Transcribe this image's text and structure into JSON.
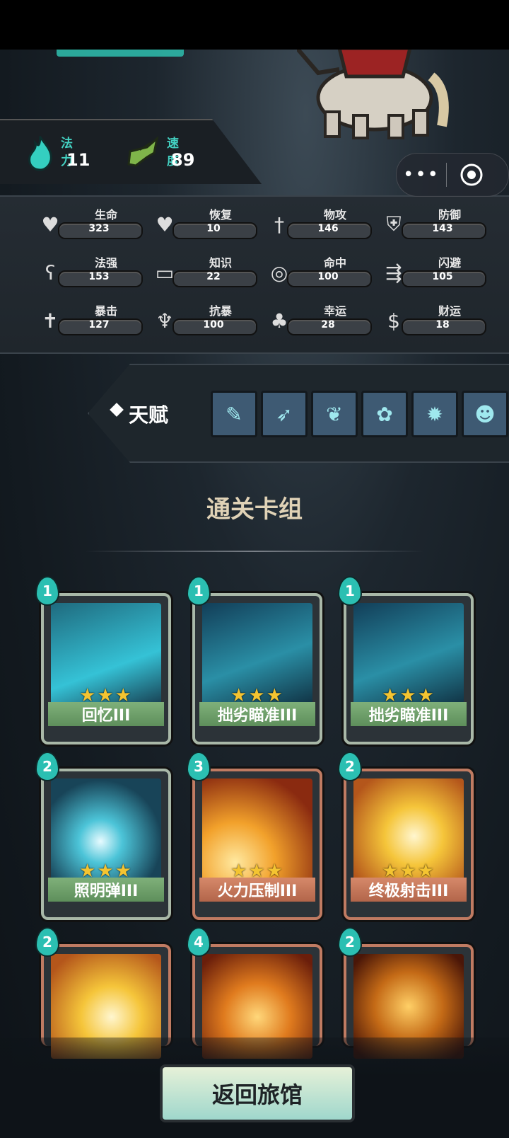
{
  "top_stats": [
    {
      "label": "法力",
      "value": "11",
      "icon": "mana-flame-icon"
    },
    {
      "label": "速度",
      "value": "89",
      "icon": "winged-boot-icon"
    }
  ],
  "stats": [
    {
      "label": "生命",
      "value": "323",
      "icon": "heart-icon"
    },
    {
      "label": "恢复",
      "value": "10",
      "icon": "heal-heart-icon"
    },
    {
      "label": "物攻",
      "value": "146",
      "icon": "sword-icon"
    },
    {
      "label": "防御",
      "value": "143",
      "icon": "armor-icon"
    },
    {
      "label": "法强",
      "value": "153",
      "icon": "magic-staff-icon"
    },
    {
      "label": "知识",
      "value": "22",
      "icon": "book-icon"
    },
    {
      "label": "命中",
      "value": "100",
      "icon": "target-icon"
    },
    {
      "label": "闪避",
      "value": "105",
      "icon": "dodge-arrows-icon"
    },
    {
      "label": "暴击",
      "value": "127",
      "icon": "crit-sword-icon"
    },
    {
      "label": "抗暴",
      "value": "100",
      "icon": "shield-shell-icon"
    },
    {
      "label": "幸运",
      "value": "28",
      "icon": "clover-icon"
    },
    {
      "label": "财运",
      "value": "18",
      "icon": "coin-icon"
    }
  ],
  "talent": {
    "label": "天赋",
    "slots": [
      "scroll-icon",
      "bow-icon",
      "branch-icon",
      "sprout-icon",
      "spiky-icon",
      "pumpkin-icon"
    ]
  },
  "deck": {
    "title": "通关卡组",
    "cards": [
      {
        "name": "回忆III",
        "cost": "1",
        "stars": "★★★",
        "type": "green"
      },
      {
        "name": "拙劣瞄准III",
        "cost": "1",
        "stars": "★★★",
        "type": "green"
      },
      {
        "name": "拙劣瞄准III",
        "cost": "1",
        "stars": "★★★",
        "type": "green"
      },
      {
        "name": "照明弹III",
        "cost": "2",
        "stars": "★★★",
        "type": "green"
      },
      {
        "name": "火力压制III",
        "cost": "3",
        "stars": "★★★",
        "type": "red"
      },
      {
        "name": "终极射击III",
        "cost": "2",
        "stars": "★★★",
        "type": "red"
      },
      {
        "name": "",
        "cost": "2",
        "stars": "",
        "type": "red"
      },
      {
        "name": "",
        "cost": "4",
        "stars": "",
        "type": "red"
      },
      {
        "name": "",
        "cost": "2",
        "stars": "",
        "type": "red"
      }
    ]
  },
  "back_button": "返回旅馆",
  "mini_program": {
    "more": "•••"
  }
}
